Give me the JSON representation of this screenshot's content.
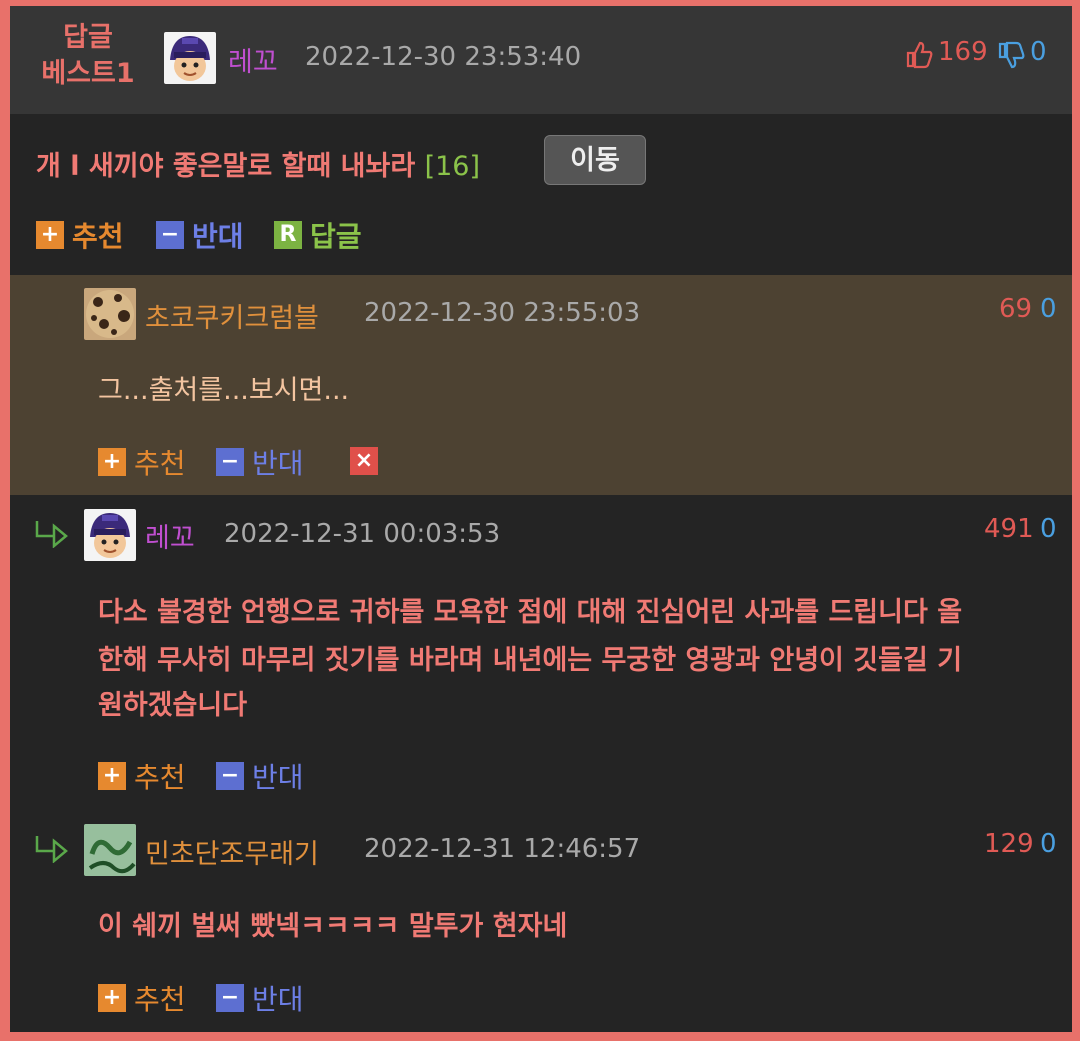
{
  "colors": {
    "accent_red": "#e8716a",
    "nick_purple": "#c04fd0",
    "nick_orange": "#e0903c",
    "highlight_bg": "#4d4232"
  },
  "best": {
    "label": "답글\n베스트1"
  },
  "main": {
    "nick": "레꼬",
    "date": "2022-12-30 23:53:40",
    "up": "169",
    "down": "0",
    "title": "개 l 새끼야 좋은말로 할때 내놔라",
    "title_count": "[16]",
    "move_label": "이동",
    "actions": {
      "recommend": "추천",
      "oppose": "반대",
      "reply": "답글"
    }
  },
  "comments": [
    {
      "nick": "초코쿠키크럼블",
      "date": "2022-12-30 23:55:03",
      "up": "69",
      "down": "0",
      "text": "그...출처를...보시면...",
      "recommend": "추천",
      "oppose": "반대"
    },
    {
      "nick": "레꼬",
      "date": "2022-12-31 00:03:53",
      "up": "491",
      "down": "0",
      "text_lines": [
        "다소 불경한 언행으로 귀하를 모욕한 점에 대해 진심어린 사과를 드립니다 올",
        "한해 무사히 마무리 짓기를 바라며 내년에는 무궁한 영광과 안녕이 깃들길 기",
        "원하겠습니다"
      ],
      "recommend": "추천",
      "oppose": "반대"
    },
    {
      "nick": "민초단조무래기",
      "date": "2022-12-31 12:46:57",
      "up": "129",
      "down": "0",
      "text": "이 쉐끼 벌써 빴넥ㅋㅋㅋㅋ 말투가 현자네",
      "recommend": "추천",
      "oppose": "반대"
    }
  ],
  "icons": {
    "plus": "+",
    "minus": "−",
    "reply": "R",
    "delete": "×"
  }
}
